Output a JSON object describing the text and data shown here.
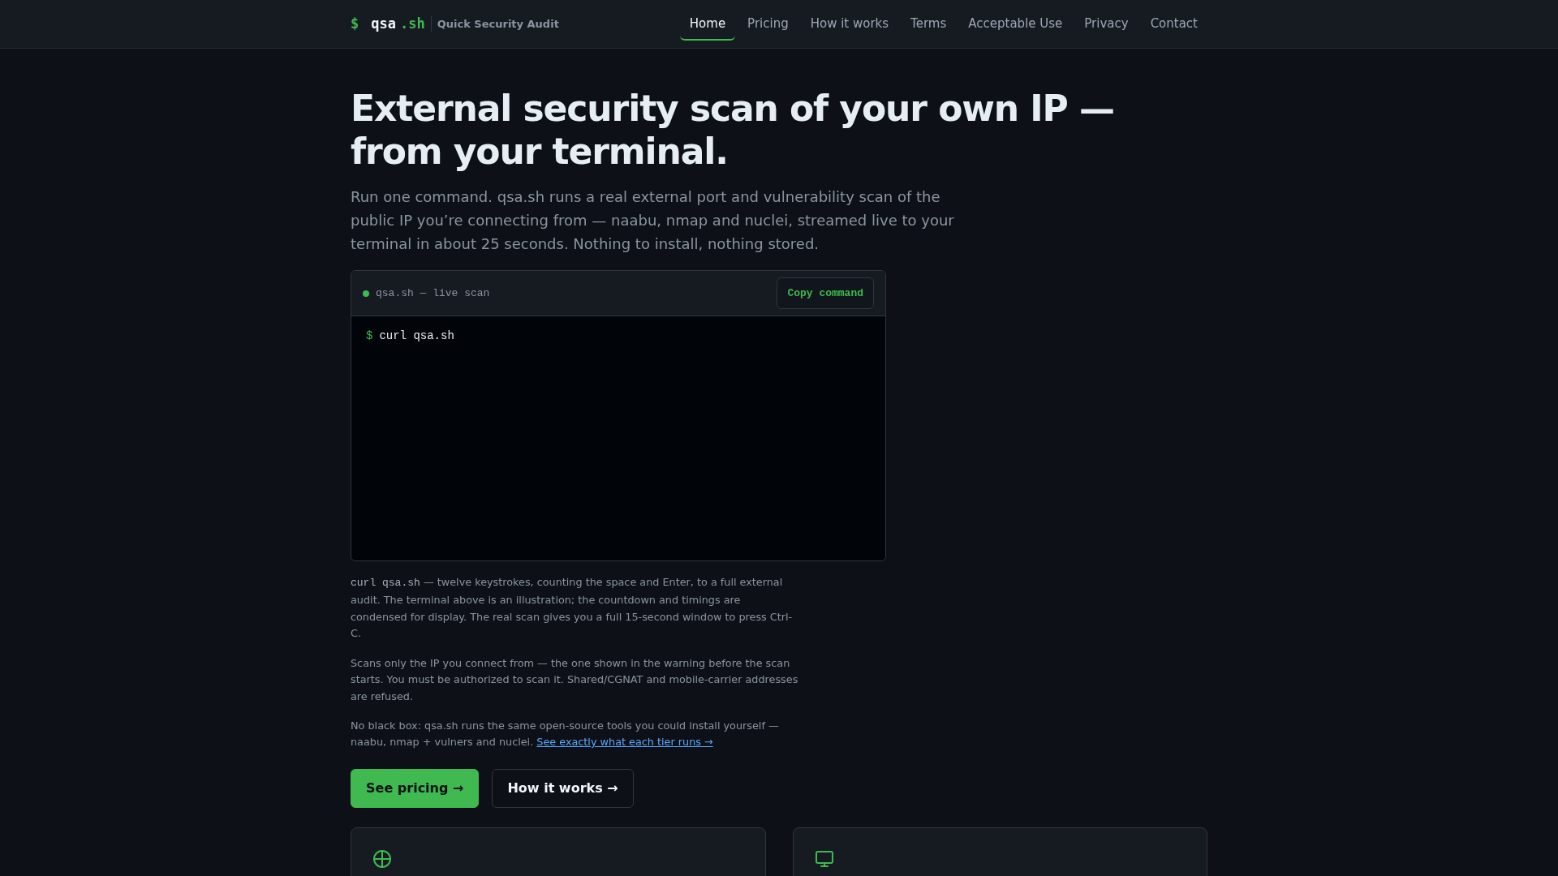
{
  "header": {
    "logo": {
      "prompt": "$",
      "name": "qsa",
      "suffix": ".sh",
      "tagline": "Quick Security Audit"
    },
    "nav": [
      {
        "label": "Home",
        "selected": true
      },
      {
        "label": "Pricing",
        "selected": false
      },
      {
        "label": "How it works",
        "selected": false
      },
      {
        "label": "Terms",
        "selected": false
      },
      {
        "label": "Acceptable Use",
        "selected": false
      },
      {
        "label": "Privacy",
        "selected": false
      },
      {
        "label": "Contact",
        "selected": false
      }
    ]
  },
  "hero": {
    "title": "External security scan of your own IP — from your terminal.",
    "lead": "Run one command. qsa.sh runs a real external port and vulnerability scan of the public IP you’re connecting from — naabu, nmap and nuclei, streamed live to your terminal in about 25 seconds. Nothing to install, nothing stored."
  },
  "terminal": {
    "title": "qsa.sh — live scan",
    "copy_button": "Copy command",
    "lines": [
      {
        "prompt": "$",
        "command": "curl qsa.sh"
      }
    ]
  },
  "notes": [
    {
      "code": "curl qsa.sh",
      "text": " — twelve keystrokes, counting the space and Enter, to a full external audit. The terminal above is an illustration; the countdown and timings are condensed for display. The real scan gives you a full 15-second window to press Ctrl-C."
    },
    {
      "text": "Scans only the IP you connect from — the one shown in the warning before the scan starts. You must be authorized to scan it. Shared/CGNAT and mobile-carrier addresses are refused."
    },
    {
      "text": "No black box: qsa.sh runs the same open-source tools you could install yourself — naabu, nmap + vulners and nuclei. ",
      "link": "See exactly what each tier runs →"
    }
  ],
  "actions": [
    {
      "label": "See pricing →",
      "kind": "primary"
    },
    {
      "label": "How it works →",
      "kind": "secondary"
    }
  ],
  "feature_cards": [
    {
      "kind": "target"
    },
    {
      "kind": "monitor"
    }
  ]
}
